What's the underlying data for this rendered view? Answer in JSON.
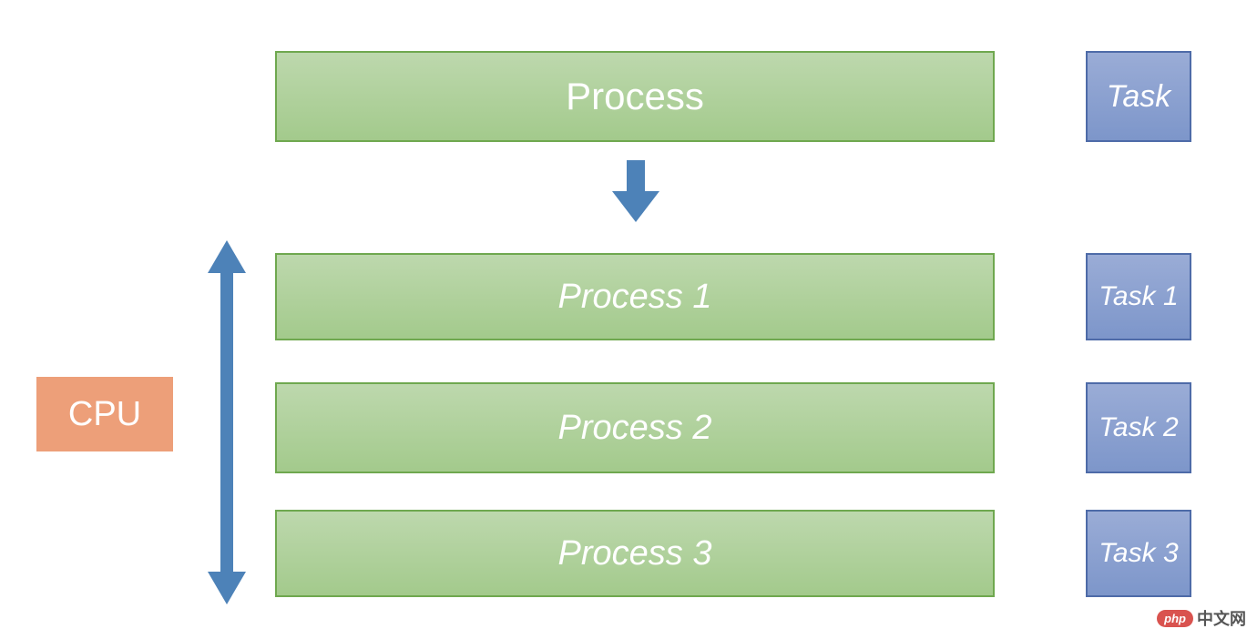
{
  "colors": {
    "green_fill_top": "#bdd8ad",
    "green_fill_bottom": "#a3ca8c",
    "green_border": "#6fa84f",
    "blue_fill_top": "#9aacd6",
    "blue_fill_bottom": "#7d96ca",
    "blue_border": "#4e6ba8",
    "orange_fill": "#ed9f79",
    "arrow_blue": "#4d82b8"
  },
  "process_top": {
    "label": "Process"
  },
  "task_top": {
    "label": "Task"
  },
  "cpu": {
    "label": "CPU"
  },
  "processes": [
    {
      "label": "Process 1"
    },
    {
      "label": "Process 2"
    },
    {
      "label": "Process 3"
    }
  ],
  "tasks": [
    {
      "label": "Task 1"
    },
    {
      "label": "Task 2"
    },
    {
      "label": "Task 3"
    }
  ],
  "watermark": {
    "badge": "php",
    "text": "中文网"
  }
}
